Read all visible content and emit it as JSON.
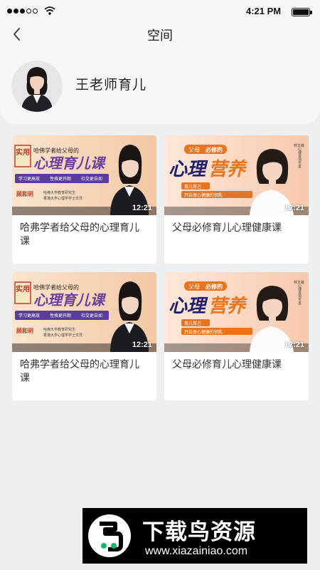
{
  "status_bar": {
    "time": "4:21 PM"
  },
  "header": {
    "title": "空间",
    "back_icon": "chevron-left-icon"
  },
  "profile": {
    "name": "王老师育儿"
  },
  "cards": [
    {
      "title": "哈弗学者给父母的心理育儿课",
      "duration": "12:21",
      "thumb": {
        "tag": "实用",
        "subtitle": "哈佛学者给父母的",
        "headline": "心理育儿课",
        "chips": [
          "学习更高效",
          "性格更开朗",
          "社交更自如"
        ],
        "teacher": "顾和玥",
        "note1": "哈佛大学教育研究生",
        "note2": "香港大学心理学学士文凭"
      }
    },
    {
      "title": "父母必修育儿心理健康课",
      "duration": "12:21",
      "thumb": {
        "tag": "父母",
        "tag2": "必修的",
        "headline1": "心理",
        "headline2": "营养",
        "chips": [
          "育儿育己",
          "开启身心健康的钥匙"
        ],
        "teacher": "林文薇",
        "note1": "心理咨询专家"
      }
    },
    {
      "title": "哈弗学者给父母的心理育儿课",
      "duration": "12:21",
      "thumb": {
        "tag": "实用",
        "subtitle": "哈佛学者给父母的",
        "headline": "心理育儿课",
        "chips": [
          "学习更高效",
          "性格更开朗",
          "社交更自如"
        ],
        "teacher": "顾和玥",
        "note1": "哈佛大学教育研究生",
        "note2": "香港大学心理学学士文凭"
      }
    },
    {
      "title": "父母必修育儿心理健康课",
      "duration": "12:21",
      "thumb": {
        "tag": "父母",
        "tag2": "必修的",
        "headline1": "心理",
        "headline2": "营养",
        "chips": [
          "育儿育己",
          "开启身心健康的钥匙"
        ],
        "teacher": "林文薇",
        "note1": "心理咨询专家"
      }
    }
  ],
  "watermark": {
    "title": "下载鸟资源",
    "url": "www.xiazainiao.com"
  },
  "colors": {
    "accent_orange": "#e8741f",
    "headline_purple": "#6b3fa0",
    "headline_dark": "#1d1f6e"
  }
}
